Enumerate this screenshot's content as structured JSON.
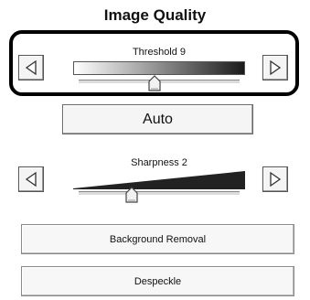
{
  "panel": {
    "title": "Image Quality"
  },
  "threshold": {
    "label": "Threshold 9",
    "level": 0.47
  },
  "auto_button": {
    "label": "Auto"
  },
  "sharpness": {
    "label": "Sharpness 2",
    "level": 0.33
  },
  "buttons": {
    "background_removal": "Background Removal",
    "despeckle": "Despeckle"
  },
  "icons": {
    "decrease": "triangle-left-icon",
    "increase": "triangle-right-icon",
    "thumb": "slider-thumb-icon"
  },
  "colors": {
    "highlight_border": "#000000",
    "gradient_start": "#ffffff",
    "gradient_end": "#1a1a1a"
  }
}
